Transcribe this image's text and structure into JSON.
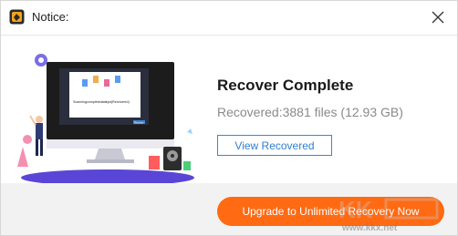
{
  "window": {
    "title": "Notice:",
    "colors": {
      "accent": "#ff6a13",
      "link": "#2f7fd3"
    }
  },
  "main": {
    "illustration": {
      "screen_caption": "Scanningcompletedatalyst(Recovered)",
      "screen_button": "Recover"
    },
    "heading": "Recover Complete",
    "stats": "Recovered:3881 files (12.93 GB)",
    "view_button": "View Recovered"
  },
  "footer": {
    "upgrade_button": "Upgrade to Unlimited Recovery Now",
    "watermark_text": "www.kkx.net"
  },
  "icons": [
    "app-logo-icon",
    "close-icon",
    "gear-icon",
    "hard-drive-icon",
    "file-icon"
  ]
}
